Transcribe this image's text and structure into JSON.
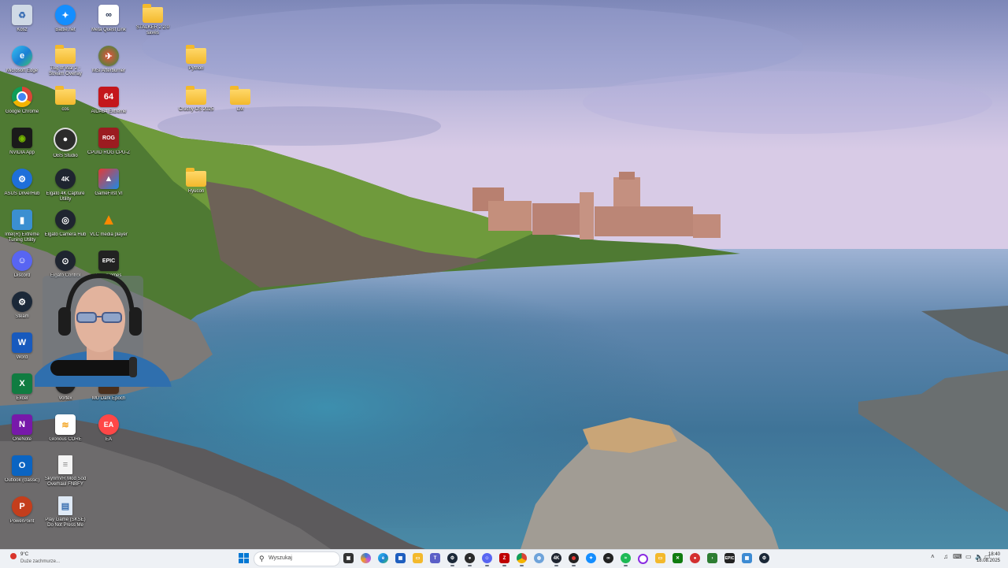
{
  "desktop": {
    "icons": [
      {
        "label": "Kosz",
        "icon": "recycle-bin-icon"
      },
      {
        "label": "Battle.net",
        "icon": "battlenet-icon"
      },
      {
        "label": "Meta Quest Link",
        "icon": "meta-icon"
      },
      {
        "label": "STALKER 2 2.0 saves",
        "icon": "folder-icon"
      },
      {
        "label": "Microsoft Edge",
        "icon": "edge-icon"
      },
      {
        "label": "Tug of War 2 - Stream Overlay",
        "icon": "folder-icon"
      },
      {
        "label": "MSI Afterburner",
        "icon": "msi-afterburner-icon"
      },
      {
        "label": "Python",
        "icon": "folder-icon"
      },
      {
        "label": "Google Chrome",
        "icon": "chrome-icon"
      },
      {
        "label": "cos",
        "icon": "folder-icon"
      },
      {
        "label": "AIDA64 Extreme",
        "icon": "aida64-icon"
      },
      {
        "label": "Cruchy OS 2025",
        "icon": "folder-icon"
      },
      {
        "label": "LM",
        "icon": "folder-icon"
      },
      {
        "label": "NVIDIA App",
        "icon": "nvidia-icon"
      },
      {
        "label": "OBS Studio",
        "icon": "obs-icon"
      },
      {
        "label": "CPUID ROG CPU-Z",
        "icon": "cpuz-icon"
      },
      {
        "label": "ASUS DriverHub",
        "icon": "asus-icon"
      },
      {
        "label": "Elgato 4K Capture Utility",
        "icon": "elgato-4k-icon"
      },
      {
        "label": "GameFirst VI",
        "icon": "gamefirst-icon"
      },
      {
        "label": "Ryucon",
        "icon": "folder-icon"
      },
      {
        "label": "Intel(R) Extreme Tuning Utility",
        "icon": "intel-xtu-icon"
      },
      {
        "label": "Elgato Camera Hub",
        "icon": "elgato-camera-icon"
      },
      {
        "label": "VLC media player",
        "icon": "vlc-icon"
      },
      {
        "label": "Discord",
        "icon": "discord-icon"
      },
      {
        "label": "Elgato Control",
        "icon": "elgato-control-icon"
      },
      {
        "label": "Epic Games",
        "icon": "epic-icon"
      },
      {
        "label": "Steam",
        "icon": "steam-icon"
      },
      {
        "label": "Word",
        "icon": "word-icon"
      },
      {
        "label": "Excel",
        "icon": "excel-icon"
      },
      {
        "label": "Vortex",
        "icon": "vortex-icon"
      },
      {
        "label": "MU Dark Epoch",
        "icon": "mu-icon"
      },
      {
        "label": "OneNote",
        "icon": "onenote-icon"
      },
      {
        "label": "Glorious CORE",
        "icon": "glorious-icon"
      },
      {
        "label": "EA",
        "icon": "ea-icon"
      },
      {
        "label": "Outlook (classic)",
        "icon": "outlook-icon"
      },
      {
        "label": "SkyrimVR Mod Sod Overhaul FNBFY",
        "icon": "document-icon"
      },
      {
        "label": "PowerPoint",
        "icon": "powerpoint-icon"
      },
      {
        "label": "Play Game (SKSE) Do Not Press Me",
        "icon": "document-icon"
      }
    ]
  },
  "taskbar": {
    "weather": {
      "temp": "9°C",
      "condition": "Duże zachmurze..."
    },
    "search_placeholder": "Wyszukaj",
    "apps": [
      "task-view-icon",
      "copilot-icon",
      "edge-icon",
      "store-icon",
      "file-explorer-icon",
      "teams-icon",
      "steam-icon",
      "obs-icon",
      "filezilla-icon",
      "chrome-icon",
      "notepad-icon",
      "elgato-icon",
      "record-icon",
      "battlenet-icon",
      "meta-icon",
      "spotify-icon",
      "circle-app-icon",
      "folder-icon",
      "xbox-icon",
      "red-app-icon",
      "terminal-icon",
      "epic-icon",
      "calculator-icon",
      "steam-icon"
    ],
    "clock": {
      "time": "18:40",
      "date": "18.08.2025"
    }
  }
}
